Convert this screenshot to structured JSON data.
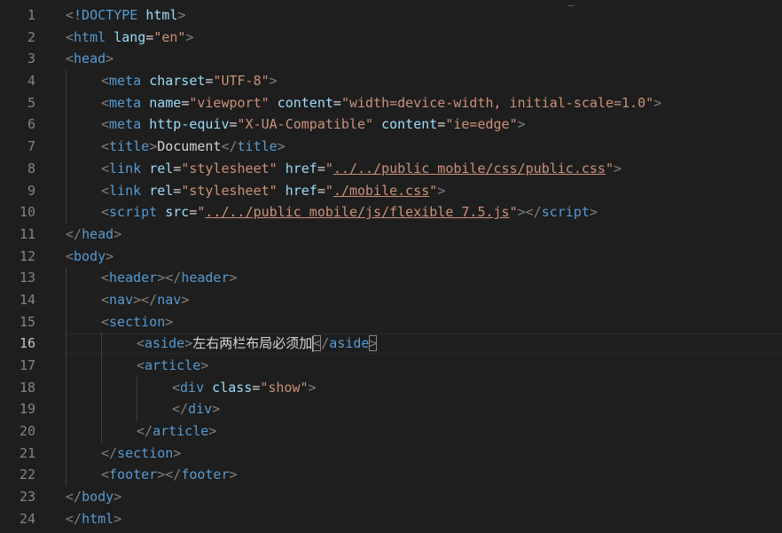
{
  "editor": {
    "lines": [
      {
        "n": "1",
        "indent": 0,
        "tokens": [
          [
            "p",
            "<"
          ],
          [
            "t",
            "!DOCTYPE"
          ],
          [
            "x",
            " "
          ],
          [
            "a",
            "html"
          ],
          [
            "p",
            ">"
          ]
        ]
      },
      {
        "n": "2",
        "indent": 0,
        "tokens": [
          [
            "p",
            "<"
          ],
          [
            "t",
            "html"
          ],
          [
            "x",
            " "
          ],
          [
            "a",
            "lang"
          ],
          [
            "e",
            "="
          ],
          [
            "s",
            "\"en\""
          ],
          [
            "p",
            ">"
          ]
        ]
      },
      {
        "n": "3",
        "indent": 0,
        "tokens": [
          [
            "p",
            "<"
          ],
          [
            "t",
            "head"
          ],
          [
            "p",
            ">"
          ]
        ]
      },
      {
        "n": "4",
        "indent": 1,
        "tokens": [
          [
            "p",
            "<"
          ],
          [
            "t",
            "meta"
          ],
          [
            "x",
            " "
          ],
          [
            "a",
            "charset"
          ],
          [
            "e",
            "="
          ],
          [
            "s",
            "\"UTF-8\""
          ],
          [
            "p",
            ">"
          ]
        ]
      },
      {
        "n": "5",
        "indent": 1,
        "tokens": [
          [
            "p",
            "<"
          ],
          [
            "t",
            "meta"
          ],
          [
            "x",
            " "
          ],
          [
            "a",
            "name"
          ],
          [
            "e",
            "="
          ],
          [
            "s",
            "\"viewport\""
          ],
          [
            "x",
            " "
          ],
          [
            "a",
            "content"
          ],
          [
            "e",
            "="
          ],
          [
            "s",
            "\"width=device-width, initial-scale=1.0\""
          ],
          [
            "p",
            ">"
          ]
        ]
      },
      {
        "n": "6",
        "indent": 1,
        "tokens": [
          [
            "p",
            "<"
          ],
          [
            "t",
            "meta"
          ],
          [
            "x",
            " "
          ],
          [
            "a",
            "http-equiv"
          ],
          [
            "e",
            "="
          ],
          [
            "s",
            "\"X-UA-Compatible\""
          ],
          [
            "x",
            " "
          ],
          [
            "a",
            "content"
          ],
          [
            "e",
            "="
          ],
          [
            "s",
            "\"ie=edge\""
          ],
          [
            "p",
            ">"
          ]
        ]
      },
      {
        "n": "7",
        "indent": 1,
        "tokens": [
          [
            "p",
            "<"
          ],
          [
            "t",
            "title"
          ],
          [
            "p",
            ">"
          ],
          [
            "x",
            "Document"
          ],
          [
            "p",
            "</"
          ],
          [
            "t",
            "title"
          ],
          [
            "p",
            ">"
          ]
        ]
      },
      {
        "n": "8",
        "indent": 1,
        "tokens": [
          [
            "p",
            "<"
          ],
          [
            "t",
            "link"
          ],
          [
            "x",
            " "
          ],
          [
            "a",
            "rel"
          ],
          [
            "e",
            "="
          ],
          [
            "s",
            "\"stylesheet\""
          ],
          [
            "x",
            " "
          ],
          [
            "a",
            "href"
          ],
          [
            "e",
            "="
          ],
          [
            "s",
            "\""
          ],
          [
            "su",
            "../../public mobile/css/public.css"
          ],
          [
            "s",
            "\""
          ],
          [
            "p",
            ">"
          ]
        ]
      },
      {
        "n": "9",
        "indent": 1,
        "tokens": [
          [
            "p",
            "<"
          ],
          [
            "t",
            "link"
          ],
          [
            "x",
            " "
          ],
          [
            "a",
            "rel"
          ],
          [
            "e",
            "="
          ],
          [
            "s",
            "\"stylesheet\""
          ],
          [
            "x",
            " "
          ],
          [
            "a",
            "href"
          ],
          [
            "e",
            "="
          ],
          [
            "s",
            "\""
          ],
          [
            "su",
            "./mobile.css"
          ],
          [
            "s",
            "\""
          ],
          [
            "p",
            ">"
          ]
        ]
      },
      {
        "n": "10",
        "indent": 1,
        "tokens": [
          [
            "p",
            "<"
          ],
          [
            "t",
            "script"
          ],
          [
            "x",
            " "
          ],
          [
            "a",
            "src"
          ],
          [
            "e",
            "="
          ],
          [
            "s",
            "\""
          ],
          [
            "su",
            "../../public mobile/js/flexible 7.5.js"
          ],
          [
            "s",
            "\""
          ],
          [
            "p",
            "></"
          ],
          [
            "t",
            "script"
          ],
          [
            "p",
            ">"
          ]
        ]
      },
      {
        "n": "11",
        "indent": 0,
        "tokens": [
          [
            "p",
            "</"
          ],
          [
            "t",
            "head"
          ],
          [
            "p",
            ">"
          ]
        ]
      },
      {
        "n": "12",
        "indent": 0,
        "tokens": [
          [
            "p",
            "<"
          ],
          [
            "t",
            "body"
          ],
          [
            "p",
            ">"
          ]
        ]
      },
      {
        "n": "13",
        "indent": 1,
        "tokens": [
          [
            "p",
            "<"
          ],
          [
            "t",
            "header"
          ],
          [
            "p",
            "></"
          ],
          [
            "t",
            "header"
          ],
          [
            "p",
            ">"
          ]
        ]
      },
      {
        "n": "14",
        "indent": 1,
        "tokens": [
          [
            "p",
            "<"
          ],
          [
            "t",
            "nav"
          ],
          [
            "p",
            "></"
          ],
          [
            "t",
            "nav"
          ],
          [
            "p",
            ">"
          ]
        ]
      },
      {
        "n": "15",
        "indent": 1,
        "tokens": [
          [
            "p",
            "<"
          ],
          [
            "t",
            "section"
          ],
          [
            "p",
            ">"
          ]
        ]
      },
      {
        "n": "16",
        "indent": 2,
        "current": true,
        "tokens": [
          [
            "p",
            "<"
          ],
          [
            "t",
            "aside"
          ],
          [
            "p",
            ">"
          ],
          [
            "x",
            "左右两栏布局必须加"
          ],
          [
            "caret",
            ""
          ],
          [
            "pb",
            "<"
          ],
          [
            "p",
            "/"
          ],
          [
            "t",
            "aside"
          ],
          [
            "pb",
            ">"
          ]
        ]
      },
      {
        "n": "17",
        "indent": 2,
        "tokens": [
          [
            "p",
            "<"
          ],
          [
            "t",
            "article"
          ],
          [
            "p",
            ">"
          ]
        ]
      },
      {
        "n": "18",
        "indent": 3,
        "tokens": [
          [
            "p",
            "<"
          ],
          [
            "t",
            "div"
          ],
          [
            "x",
            " "
          ],
          [
            "a",
            "class"
          ],
          [
            "e",
            "="
          ],
          [
            "s",
            "\"show\""
          ],
          [
            "p",
            ">"
          ]
        ]
      },
      {
        "n": "19",
        "indent": 3,
        "tokens": [
          [
            "p",
            "</"
          ],
          [
            "t",
            "div"
          ],
          [
            "p",
            ">"
          ]
        ]
      },
      {
        "n": "20",
        "indent": 2,
        "tokens": [
          [
            "p",
            "</"
          ],
          [
            "t",
            "article"
          ],
          [
            "p",
            ">"
          ]
        ]
      },
      {
        "n": "21",
        "indent": 1,
        "tokens": [
          [
            "p",
            "</"
          ],
          [
            "t",
            "section"
          ],
          [
            "p",
            ">"
          ]
        ]
      },
      {
        "n": "22",
        "indent": 1,
        "tokens": [
          [
            "p",
            "<"
          ],
          [
            "t",
            "footer"
          ],
          [
            "p",
            "></"
          ],
          [
            "t",
            "footer"
          ],
          [
            "p",
            ">"
          ]
        ]
      },
      {
        "n": "23",
        "indent": 0,
        "tokens": [
          [
            "p",
            "</"
          ],
          [
            "t",
            "body"
          ],
          [
            "p",
            ">"
          ]
        ]
      },
      {
        "n": "24",
        "indent": 0,
        "tokens": [
          [
            "p",
            "</"
          ],
          [
            "t",
            "html"
          ],
          [
            "p",
            ">"
          ]
        ]
      }
    ]
  },
  "colors": {
    "background": "#1e1e1e",
    "tag": "#569cd6",
    "attribute": "#9cdcfe",
    "string": "#ce9178",
    "punctuation": "#808080",
    "text": "#d4d4d4",
    "line_number": "#858585"
  }
}
